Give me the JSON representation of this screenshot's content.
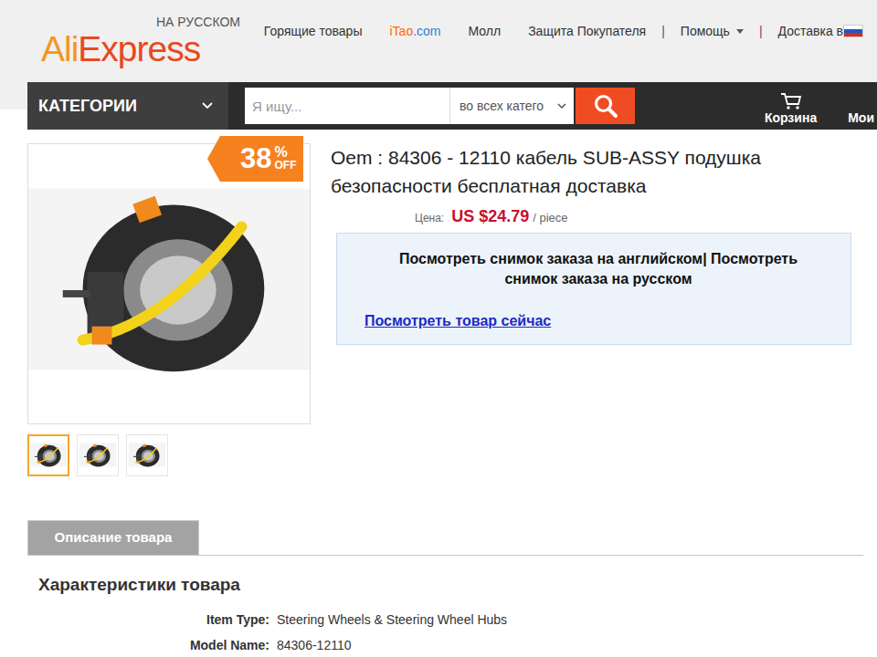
{
  "header": {
    "logo": {
      "parts": [
        "Ali",
        "Express"
      ],
      "tagline": "НА РУССКОМ"
    },
    "nav": [
      {
        "kind": "link",
        "label": "Горящие товары"
      },
      {
        "kind": "brand",
        "parts": [
          "i",
          "Tao",
          ".com"
        ]
      },
      {
        "kind": "link",
        "label": "Молл"
      },
      {
        "kind": "link",
        "label": "Защита Покупателя"
      },
      {
        "kind": "separator",
        "label": "|"
      },
      {
        "kind": "dropdown",
        "label": "Помощь"
      },
      {
        "kind": "separator",
        "label": "|"
      },
      {
        "kind": "flag",
        "label": "Доставка в"
      }
    ]
  },
  "search_bar": {
    "categories": "КАТЕГОРИИ",
    "placeholder": "Я ищу...",
    "scope": "во всех катего",
    "cart": "Корзина",
    "account": "Мои"
  },
  "product": {
    "badge": {
      "value": "38",
      "percent": "%",
      "off": "OFF"
    },
    "title": "Oem : 84306 - 12110 кабель SUB-ASSY подушка безопасности бесплатная доставка",
    "price_label": "Цена:",
    "price": "US $24.79",
    "unit": "/ piece",
    "snapshot": {
      "english": "Посмотреть снимок заказа на английском",
      "separator": "|",
      "russian": "Посмотреть снимок заказа на русском",
      "view_now": "Посмотреть товар сейчас"
    },
    "thumbnails": [
      {
        "selected": true
      },
      {
        "selected": false
      },
      {
        "selected": false
      }
    ]
  },
  "tabs": [
    {
      "label": "Описание товара",
      "selected": true
    }
  ],
  "specs": {
    "heading": "Характеристики товара",
    "rows": [
      {
        "label": "Item Type:",
        "value": "Steering Wheels & Steering Wheel Hubs"
      },
      {
        "label": "Model Name:",
        "value": "84306-12110"
      }
    ]
  }
}
